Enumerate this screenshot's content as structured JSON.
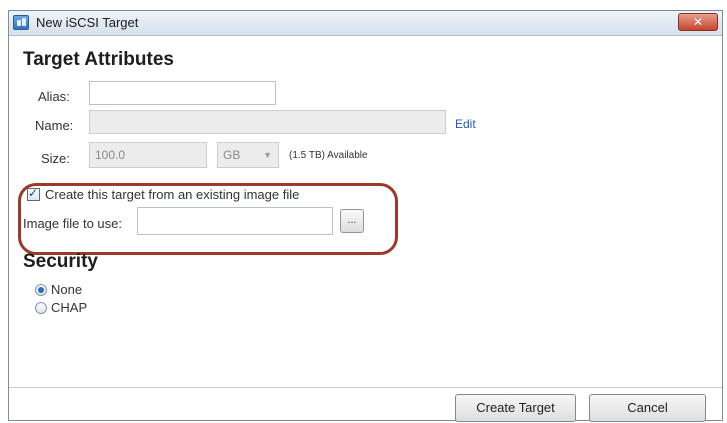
{
  "window": {
    "title": "New iSCSI Target",
    "close_label": "✕"
  },
  "attributes": {
    "heading": "Target Attributes",
    "alias_label": "Alias:",
    "alias_value": "",
    "name_label": "Name:",
    "name_value": "",
    "edit_link": "Edit",
    "size_label": "Size:",
    "size_value": "100.0",
    "size_unit": "GB",
    "available": "(1.5 TB) Available"
  },
  "image_file": {
    "checkbox_label": "Create this target from an existing image file",
    "checked": true,
    "file_label": "Image file to use:",
    "file_value": "",
    "browse_label": "..."
  },
  "security": {
    "heading": "Security",
    "options": [
      {
        "label": "None",
        "selected": true
      },
      {
        "label": "CHAP",
        "selected": false
      }
    ]
  },
  "buttons": {
    "create": "Create Target",
    "cancel": "Cancel"
  },
  "icons": [
    "iscsi-app-icon",
    "close-icon",
    "chevron-down-icon",
    "checkmark-icon"
  ],
  "colors": {
    "highlight_ring": "#9c3a2a",
    "link": "#2058b0",
    "close_button": "#c6452f"
  }
}
